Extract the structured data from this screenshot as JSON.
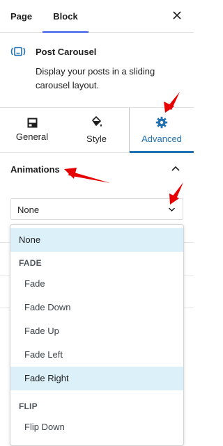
{
  "top_tabs": [
    {
      "label": "Page"
    },
    {
      "label": "Block"
    }
  ],
  "block": {
    "title": "Post Carousel",
    "description": "Display your posts in a sliding carousel layout."
  },
  "inspector_tabs": [
    {
      "label": "General",
      "icon": "layout-icon"
    },
    {
      "label": "Style",
      "icon": "paint-bucket-icon"
    },
    {
      "label": "Advanced",
      "icon": "gear-icon",
      "active": true
    }
  ],
  "panel": {
    "title": "Animations",
    "select_value": "None"
  },
  "dropdown": {
    "options": [
      {
        "label": "None",
        "selected": true
      },
      {
        "group": "FADE"
      },
      {
        "label": "Fade"
      },
      {
        "label": "Fade Down"
      },
      {
        "label": "Fade Up"
      },
      {
        "label": "Fade Left"
      },
      {
        "label": "Fade Right",
        "selected": true
      },
      {
        "group": "FLIP"
      },
      {
        "label": "Flip Down"
      }
    ]
  },
  "colors": {
    "accent": "#2271b1",
    "tab_underline": "#3858e9",
    "selected_bg": "#dcf0fa",
    "annotation": "#e60000"
  }
}
